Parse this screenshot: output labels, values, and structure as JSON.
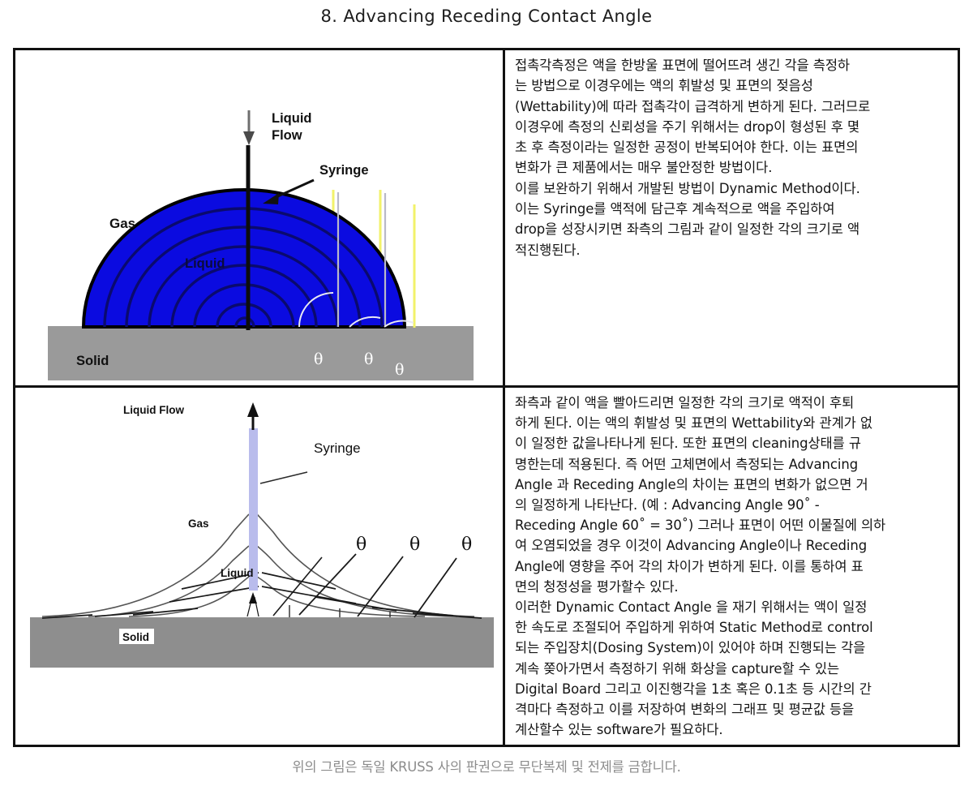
{
  "document": {
    "title": "8. Advancing Receding Contact Angle",
    "footer_note": "위의 그림은 독일 KRUSS 사의 판권으로 무단복제 및 전제를 금합니다."
  },
  "panels": {
    "advancing": {
      "figure": {
        "caption_flow": "Liquid\nFlow",
        "label_flow_line1": "Liquid",
        "label_flow_line2": "Flow",
        "label_syringe": "Syringe",
        "label_gas": "Gas",
        "label_liquid": "Liquid",
        "label_solid": "Solid",
        "angle_symbol": "θ",
        "angle_markers": [
          "θ",
          "θ",
          "θ"
        ],
        "colors": {
          "drop_fill": "#0b0be0",
          "drop_outline": "#000000",
          "arc_stroke": "#0a0a6e",
          "substrate": "#9a9a9a",
          "tangent_line": "#f2f26a",
          "normal_line": "#b9b9c8",
          "needle": "#0d0d0d",
          "flow_arrow": "#6f6f6f"
        }
      },
      "text": "접촉각측정은 액을 한방울 표면에 떨어뜨려 생긴 각을 측정하\n는 방법으로 이경우에는 액의 휘발성 및 표면의 젖음성\n(Wettability)에 따라 접촉각이 급격하게 변하게 된다. 그러므로\n이경우에 측정의 신뢰성을 주기 위해서는 drop이 형성된 후 몇\n초 후 측정이라는 일정한 공정이 반복되어야 한다. 이는 표면의\n변화가 큰 제품에서는 매우 불안정한 방법이다.\n이를 보완하기 위해서 개발된 방법이 Dynamic Method이다.\n이는 Syringe를 액적에 담근후 계속적으로 액을 주입하여\ndrop을 성장시키면 좌측의 그림과 같이 일정한 각의 크기로 액\n적진행된다."
    },
    "receding": {
      "figure": {
        "label_flow": "Liquid Flow",
        "label_syringe": "Syringe",
        "label_gas": "Gas",
        "label_liquid": "Liquid",
        "label_solid": "Solid",
        "angle_symbol": "θ",
        "angle_markers": [
          "θ",
          "θ",
          "θ"
        ],
        "colors": {
          "syringe_fill": "#b9bcec",
          "profile_stroke": "#555555",
          "tangent_stroke": "#1a1a1a",
          "substrate": "#8e8e8e",
          "flow_arrow": "#111111"
        }
      },
      "text": "좌측과 같이 액을 빨아드리면 일정한 각의 크기로 액적이 후퇴\n하게 된다. 이는 액의 휘발성 및 표면의 Wettability와 관계가 없\n이 일정한 값을나타나게 된다. 또한 표면의 cleaning상태를 규\n명한는데 적용된다. 즉 어떤 고체면에서 측정되는 Advancing\nAngle 과 Receding Angle의 차이는 표면의 변화가 없으면 거\n의 일정하게 나타난다. (예 : Advancing Angle 90˚ -\nReceding Angle 60˚ = 30˚) 그러나 표면이 어떤 이물질에 의하\n여 오염되었을 경우 이것이 Advancing Angle이나 Receding\nAngle에 영향을 주어 각의 차이가 변하게 된다. 이를 통하여 표\n면의 청정성을 평가할수 있다.\n이러한 Dynamic Contact Angle 을 재기 위해서는 액이 일정\n한 속도로 조절되어 주입하게 위하여 Static Method로 control\n되는 주입장치(Dosing System)이 있어야 하며 진행되는 각을\n계속 쫒아가면서 측정하기 위해 화상을 capture할 수 있는\nDigital Board 그리고 이진행각을 1초 혹은 0.1초 등 시간의 간\n격마다 측정하고 이를 저장하여 변화의 그래프 및 평균값 등을\n계산할수 있는 software가 필요하다."
    }
  }
}
